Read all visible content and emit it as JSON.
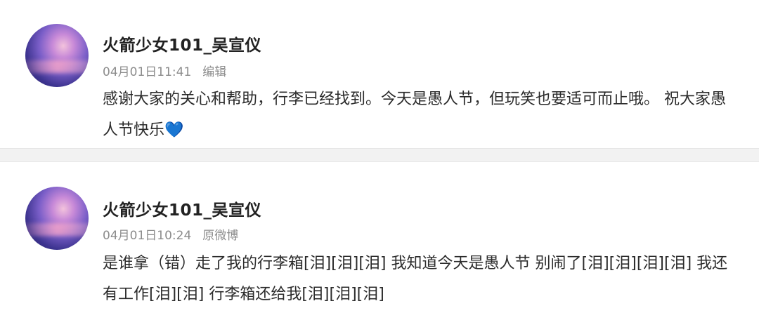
{
  "posts": [
    {
      "username": "火箭少女101_吴宣仪",
      "time": "04月01日11:41",
      "tag": "编辑",
      "content": "感谢大家的关心和帮助，行李已经找到。今天是愚人节，但玩笑也要适可而止哦。 祝大家愚人节快乐",
      "emoji": "💙"
    },
    {
      "username": "火箭少女101_吴宣仪",
      "time": "04月01日10:24",
      "tag": "原微博",
      "content": "是谁拿（错）走了我的行李箱[泪][泪][泪] 我知道今天是愚人节 别闹了[泪][泪][泪][泪] 我还有工作[泪][泪] 行李箱还给我[泪][泪][泪]"
    }
  ],
  "colors": {
    "background": "#f2f2f2",
    "card": "#ffffff",
    "meta_text": "#8c8c8c",
    "heart": "#2f8cf0"
  },
  "icons": [
    "avatar-image",
    "blue-heart-emoji"
  ]
}
